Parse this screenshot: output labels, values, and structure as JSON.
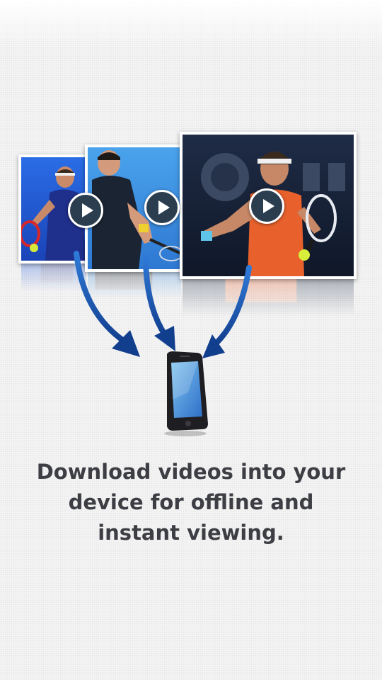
{
  "message": "Download videos into your device for offline and instant viewing.",
  "icons": [
    "play-icon",
    "download-arrow-icon",
    "smartphone-icon"
  ],
  "colors": {
    "text": "#3d3e44",
    "arrow": "#1e5bb8",
    "play_button": "#2b3e50",
    "background": "#f4f4f4"
  }
}
